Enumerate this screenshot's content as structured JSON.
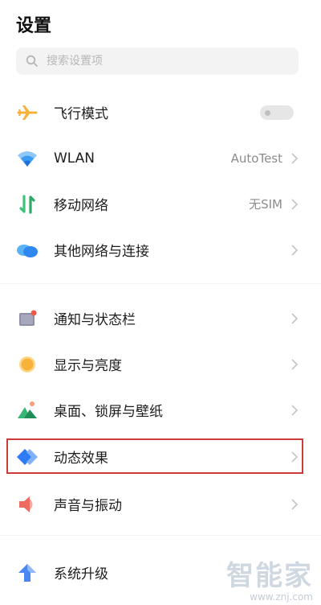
{
  "header": {
    "title": "设置"
  },
  "search": {
    "placeholder": "搜索设置项"
  },
  "items": [
    {
      "label": "飞行模式",
      "value": "",
      "icon": "airplane-icon",
      "toggle": false
    },
    {
      "label": "WLAN",
      "value": "AutoTest",
      "icon": "wifi-icon"
    },
    {
      "label": "移动网络",
      "value": "无SIM",
      "icon": "mobile-network-icon"
    },
    {
      "label": "其他网络与连接",
      "value": "",
      "icon": "cloud-icon"
    },
    {
      "label": "通知与状态栏",
      "value": "",
      "icon": "notification-icon"
    },
    {
      "label": "显示与亮度",
      "value": "",
      "icon": "sun-icon"
    },
    {
      "label": "桌面、锁屏与壁纸",
      "value": "",
      "icon": "wallpaper-icon"
    },
    {
      "label": "动态效果",
      "value": "",
      "icon": "motion-effect-icon"
    },
    {
      "label": "声音与振动",
      "value": "",
      "icon": "speaker-icon"
    },
    {
      "label": "系统升级",
      "value": "",
      "icon": "upgrade-arrow-icon"
    }
  ],
  "watermark": {
    "brand": "智能家",
    "site": "www.znj.com"
  },
  "colors": {
    "highlight": "#cf3b3b",
    "accent_blue": "#2f7bf5",
    "airplane": "#f5b33b"
  }
}
